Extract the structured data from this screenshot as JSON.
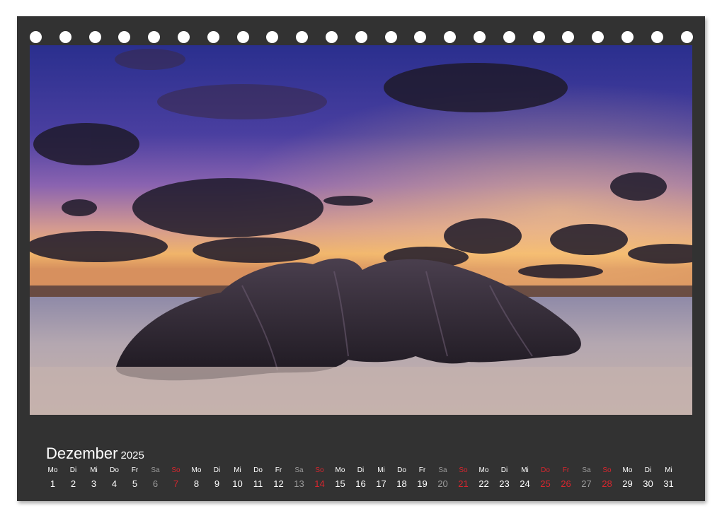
{
  "calendar": {
    "month": "Dezember",
    "year": "2025",
    "days": [
      {
        "wd": "Mo",
        "d": "1",
        "type": "normal"
      },
      {
        "wd": "Di",
        "d": "2",
        "type": "normal"
      },
      {
        "wd": "Mi",
        "d": "3",
        "type": "normal"
      },
      {
        "wd": "Do",
        "d": "4",
        "type": "normal"
      },
      {
        "wd": "Fr",
        "d": "5",
        "type": "normal"
      },
      {
        "wd": "Sa",
        "d": "6",
        "type": "sat"
      },
      {
        "wd": "So",
        "d": "7",
        "type": "sun"
      },
      {
        "wd": "Mo",
        "d": "8",
        "type": "normal"
      },
      {
        "wd": "Di",
        "d": "9",
        "type": "normal"
      },
      {
        "wd": "Mi",
        "d": "10",
        "type": "normal"
      },
      {
        "wd": "Do",
        "d": "11",
        "type": "normal"
      },
      {
        "wd": "Fr",
        "d": "12",
        "type": "normal"
      },
      {
        "wd": "Sa",
        "d": "13",
        "type": "sat"
      },
      {
        "wd": "So",
        "d": "14",
        "type": "sun"
      },
      {
        "wd": "Mo",
        "d": "15",
        "type": "normal"
      },
      {
        "wd": "Di",
        "d": "16",
        "type": "normal"
      },
      {
        "wd": "Mi",
        "d": "17",
        "type": "normal"
      },
      {
        "wd": "Do",
        "d": "18",
        "type": "normal"
      },
      {
        "wd": "Fr",
        "d": "19",
        "type": "normal"
      },
      {
        "wd": "Sa",
        "d": "20",
        "type": "sat"
      },
      {
        "wd": "So",
        "d": "21",
        "type": "sun"
      },
      {
        "wd": "Mo",
        "d": "22",
        "type": "normal"
      },
      {
        "wd": "Di",
        "d": "23",
        "type": "normal"
      },
      {
        "wd": "Mi",
        "d": "24",
        "type": "normal"
      },
      {
        "wd": "Do",
        "d": "25",
        "type": "sun"
      },
      {
        "wd": "Fr",
        "d": "26",
        "type": "sun"
      },
      {
        "wd": "Sa",
        "d": "27",
        "type": "sat"
      },
      {
        "wd": "So",
        "d": "28",
        "type": "sun"
      },
      {
        "wd": "Mo",
        "d": "29",
        "type": "normal"
      },
      {
        "wd": "Di",
        "d": "30",
        "type": "normal"
      },
      {
        "wd": "Mi",
        "d": "31",
        "type": "normal"
      }
    ]
  },
  "colors": {
    "frame": "#323232",
    "holiday_red": "#d8262e",
    "saturday_gray": "#9b9b9b"
  }
}
